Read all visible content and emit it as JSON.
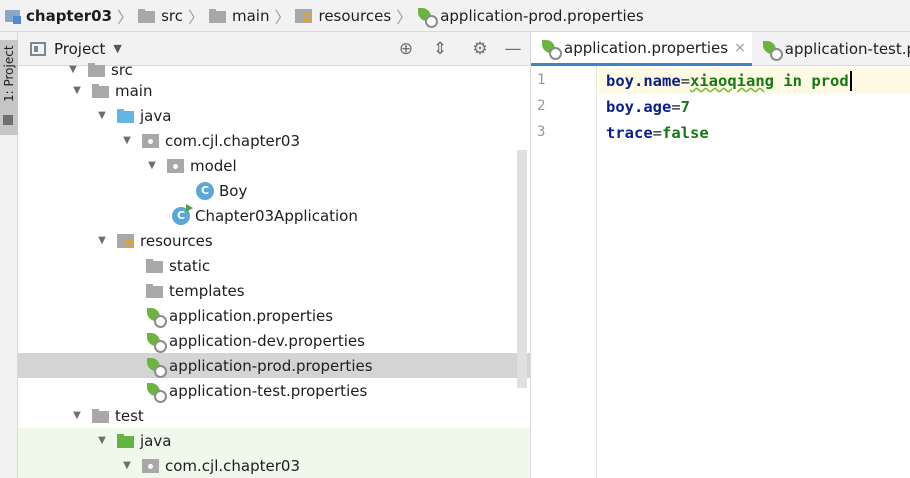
{
  "breadcrumb": {
    "items": [
      "chapter03",
      "src",
      "main",
      "resources",
      "application-prod.properties"
    ]
  },
  "side_strip": {
    "tab_label": "1: Project"
  },
  "project_panel": {
    "title": "Project",
    "tree": [
      {
        "label": "src"
      },
      {
        "label": "main"
      },
      {
        "label": "java"
      },
      {
        "label": "com.cjl.chapter03"
      },
      {
        "label": "model"
      },
      {
        "label": "Boy",
        "icon_letter": "C"
      },
      {
        "label": "Chapter03Application",
        "icon_letter": "C"
      },
      {
        "label": "resources"
      },
      {
        "label": "static"
      },
      {
        "label": "templates"
      },
      {
        "label": "application.properties"
      },
      {
        "label": "application-dev.properties"
      },
      {
        "label": "application-prod.properties"
      },
      {
        "label": "application-test.properties"
      },
      {
        "label": "test"
      },
      {
        "label": "java"
      },
      {
        "label": "com.cjl.chapter03"
      }
    ]
  },
  "editor": {
    "tabs": [
      {
        "label": "application.properties",
        "close": "×"
      },
      {
        "label": "application-test.properties"
      }
    ],
    "line_numbers": [
      "1",
      "2",
      "3"
    ],
    "lines": [
      {
        "key": "boy.name",
        "eq": "=",
        "value": "xiaoqiang",
        "rest": " in prod"
      },
      {
        "key": "boy.age",
        "eq": "=",
        "value": "7"
      },
      {
        "key": "trace",
        "eq": "=",
        "value": "false"
      }
    ]
  },
  "colors": {
    "selection": "#d4d4d4",
    "test_tint": "#eff8ea",
    "current_line": "#fffae3",
    "key": "#0b1f8a",
    "value": "#137a13"
  }
}
